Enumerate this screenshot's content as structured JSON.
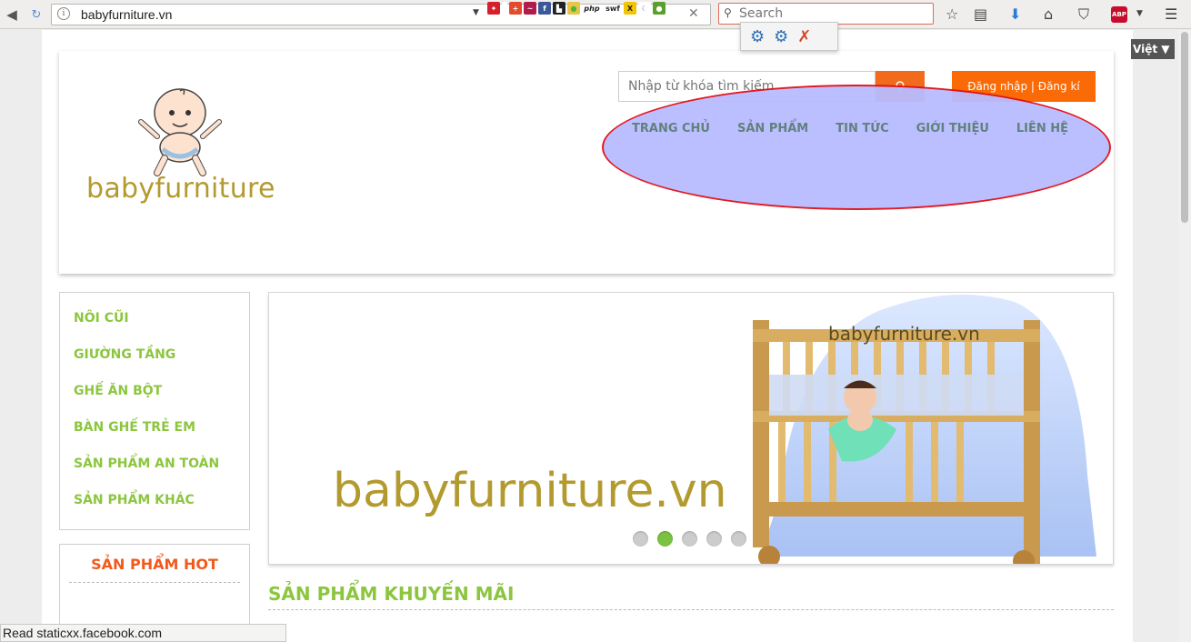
{
  "browser": {
    "url": "babyfurniture.vn",
    "search_placeholder": "Search",
    "status_text": "Read staticxx.facebook.com"
  },
  "page": {
    "language_label": "Việt ▼",
    "logo_text": "babyfurniture",
    "search_placeholder": "Nhập từ khóa tìm kiếm",
    "login_label": "Đăng nhập | Đăng kí",
    "nav": [
      {
        "label": "TRANG CHỦ"
      },
      {
        "label": "SẢN PHẨM"
      },
      {
        "label": "TIN TỨC"
      },
      {
        "label": "GIỚI THIỆU"
      },
      {
        "label": "LIÊN HỆ"
      }
    ],
    "categories": [
      {
        "label": "NÔI CŨI"
      },
      {
        "label": "GIƯỜNG TẦNG"
      },
      {
        "label": "GHẾ ĂN BỘT"
      },
      {
        "label": "BÀN GHẾ TRẺ EM"
      },
      {
        "label": "SẢN PHẨM AN TOÀN"
      },
      {
        "label": "SẢN PHẨM KHÁC"
      }
    ],
    "hot_title": "SẢN PHẨM HOT",
    "slider": {
      "text": "babyfurniture.vn",
      "crib_sign": "babyfurniture.vn",
      "slide_count": 5,
      "active_slide": 2
    },
    "promo_title": "SẢN PHẨM KHUYẾN MÃI"
  },
  "colors": {
    "accent_orange": "#fa6a06",
    "category_green": "#8cc63f",
    "nav_text": "#61817c",
    "highlight_fill": "#b9bcff",
    "highlight_border": "#e00f17"
  }
}
